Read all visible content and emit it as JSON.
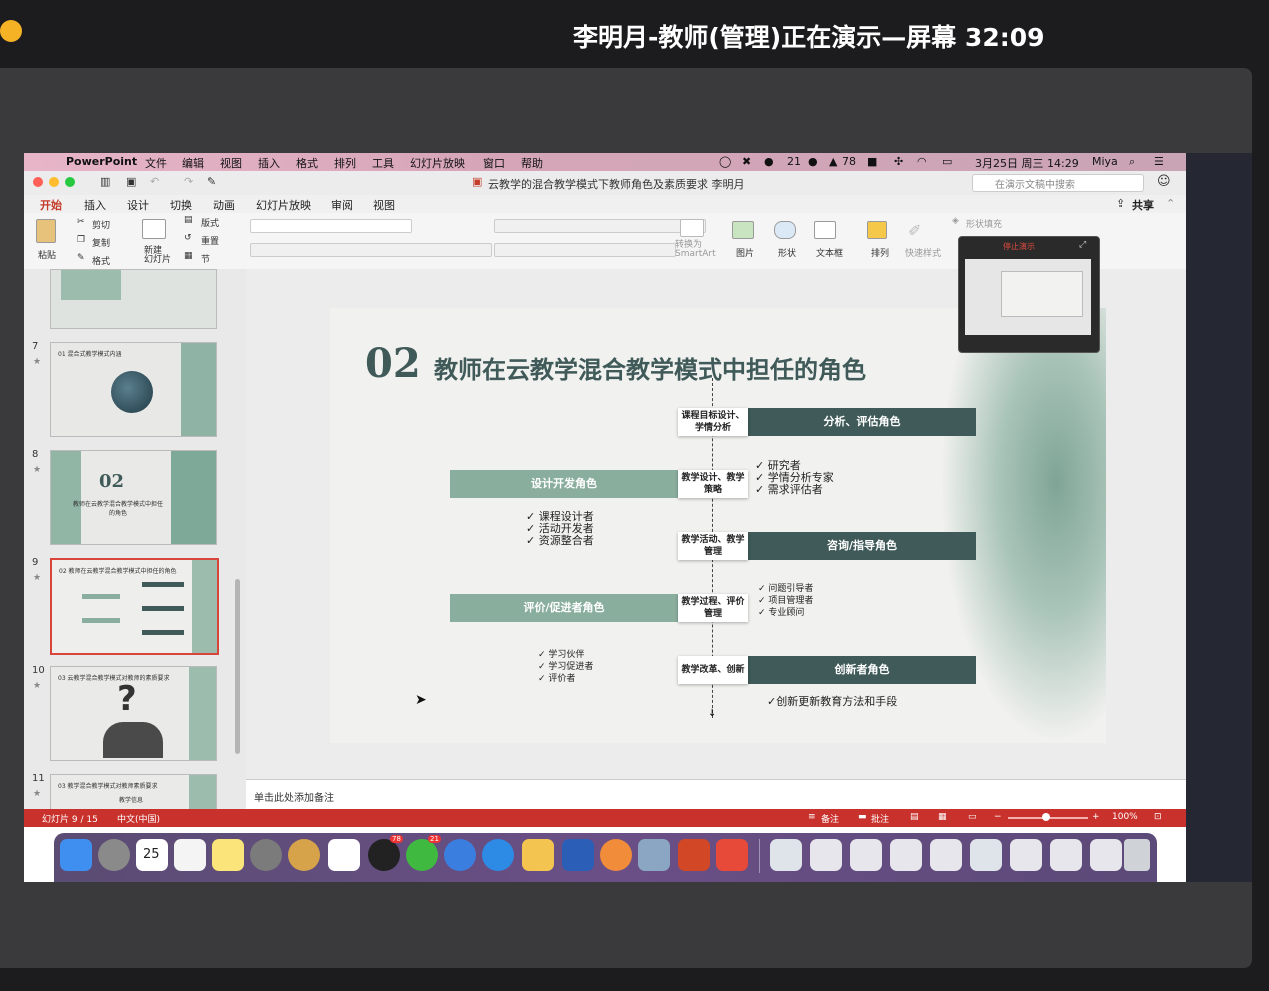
{
  "meeting": {
    "title": "李明月-教师(管理)正在演示—屏幕 32:09"
  },
  "menubar": {
    "app": "PowerPoint",
    "menus": [
      "文件",
      "编辑",
      "视图",
      "插入",
      "格式",
      "排列",
      "工具",
      "幻灯片放映",
      "窗口",
      "帮助"
    ],
    "wechat_badge": "21",
    "bell_badge": "78",
    "datetime": "3月25日 周三 14:29",
    "user": "Miya"
  },
  "window": {
    "doc_title": "云教学的混合教学模式下教师角色及素质要求 李明月",
    "search_placeholder": "在演示文稿中搜索"
  },
  "ribbon_tabs": [
    "开始",
    "插入",
    "设计",
    "切换",
    "动画",
    "幻灯片放映",
    "审阅",
    "视图"
  ],
  "share_label": "共享",
  "ribbon": {
    "paste": "粘贴",
    "cut": "剪切",
    "copy": "复制",
    "format": "格式",
    "new_slide": "新建\n幻灯片",
    "layout": "版式",
    "reset": "重置",
    "section": "节",
    "convert": "转换为\nSmartArt",
    "picture": "图片",
    "shape": "形状",
    "textbox": "文本框",
    "arrange": "排列",
    "quick_style": "快速样式",
    "shape_fill": "形状填充"
  },
  "popup": {
    "stop": "停止演示"
  },
  "thumbnails": [
    {
      "num": "7",
      "title": "01 混合式教学模式内涵"
    },
    {
      "num": "8",
      "title": "02",
      "sub": "教师在云教学混合教学模式中担任的角色"
    },
    {
      "num": "9",
      "title": "02 教师在云教学混合教学模式中担任的角色"
    },
    {
      "num": "10",
      "title": "03 云教学混合教学模式对教师的素质要求"
    },
    {
      "num": "11",
      "title": "03 教学混合教学模式对教师素质要求",
      "sub": "教学信息"
    }
  ],
  "slide": {
    "number": "02",
    "title": "教师在云教学混合教学模式中担任的角色",
    "rows": [
      {
        "pill": "课程目标设计、学情分析",
        "role": "分析、评估角色"
      },
      {
        "pill": "教学设计、教学策略",
        "role": "设计开发角色"
      },
      {
        "pill": "教学活动、教学管理",
        "role": "咨询/指导角色"
      },
      {
        "pill": "教学过程、评价管理",
        "role": "评价/促进者角色"
      },
      {
        "pill": "教学改革、创新",
        "role": "创新者角色"
      }
    ],
    "bullets_analysis": [
      "研究者",
      "学情分析专家",
      "需求评估者"
    ],
    "bullets_design": [
      "课程设计者",
      "活动开发者",
      "资源整合者"
    ],
    "bullets_guide": [
      "问题引导者",
      "项目管理者",
      "专业顾问"
    ],
    "bullets_eval": [
      "学习伙伴",
      "学习促进者",
      "评价者"
    ],
    "bullets_innov": [
      "创新更新教育方法和手段"
    ],
    "check": "✓"
  },
  "notes_placeholder": "单击此处添加备注",
  "status": {
    "slide_info": "幻灯片 9 / 15",
    "language": "中文(中国)",
    "notes": "备注",
    "comments": "批注",
    "zoom": "100%"
  },
  "dock": {
    "calendar_day": "25",
    "qq_badge": "78",
    "wechat_badge": "21"
  }
}
